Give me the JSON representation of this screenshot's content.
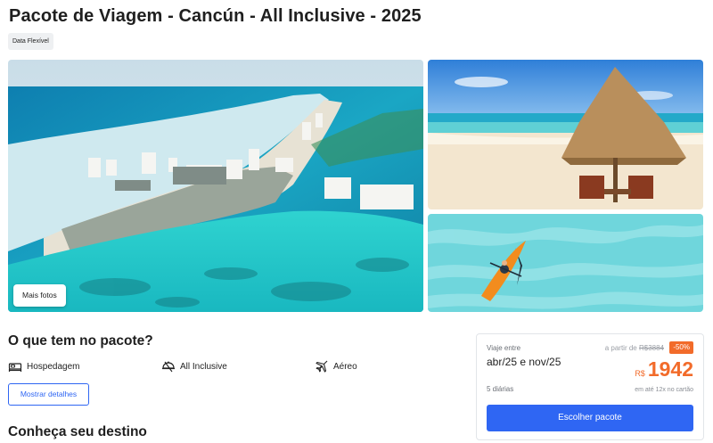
{
  "header": {
    "title": "Pacote de Viagem - Cancún - All Inclusive - 2025",
    "tag": "Data Flexível"
  },
  "gallery": {
    "more_photos_label": "Mais fotos"
  },
  "package_section": {
    "title": "O que tem no pacote?",
    "features": [
      {
        "icon": "bed-icon",
        "label": "Hospedagem"
      },
      {
        "icon": "dining-icon",
        "label": "All Inclusive"
      },
      {
        "icon": "airplane-icon",
        "label": "Aéreo"
      }
    ],
    "details_button": "Mostrar detalhes"
  },
  "destination_section": {
    "title": "Conheça seu destino"
  },
  "price_card": {
    "trip_label": "Viaje entre",
    "dates": "abr/25 e nov/25",
    "from_label": "a partir de",
    "old_price": "R$3884",
    "discount": "-50%",
    "currency": "R$",
    "price": "1942",
    "nights": "5 diárias",
    "installments": "em até 12x no cartão",
    "cta": "Escolher pacote"
  },
  "colors": {
    "primary": "#2f66f3",
    "accent": "#f26b2a"
  }
}
